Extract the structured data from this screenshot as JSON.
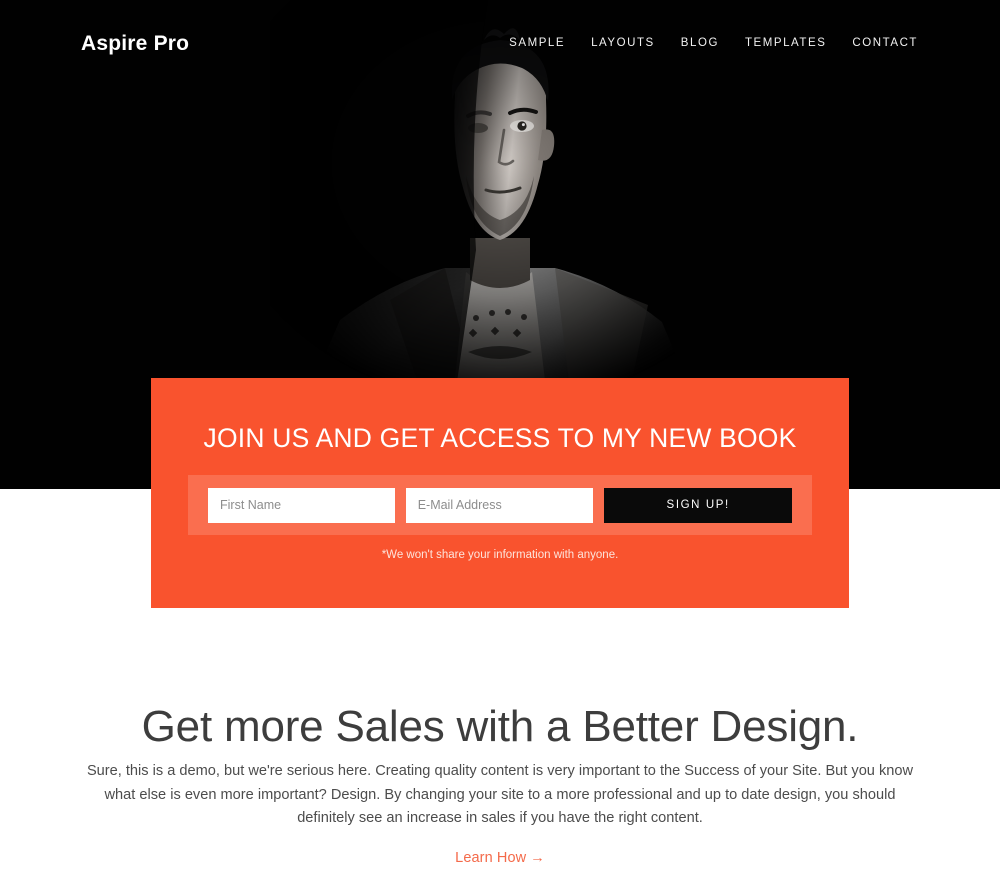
{
  "header": {
    "logo": "Aspire Pro",
    "nav": [
      {
        "label": "SAMPLE"
      },
      {
        "label": "LAYOUTS"
      },
      {
        "label": "BLOG"
      },
      {
        "label": "TEMPLATES"
      },
      {
        "label": "CONTACT"
      }
    ]
  },
  "hero": {
    "image_description": "black-and-white portrait of a man in a denim jacket on a black background",
    "background_color": "#010101"
  },
  "optin": {
    "title": "JOIN US AND GET ACCESS TO MY NEW BOOK",
    "first_name_placeholder": "First Name",
    "first_name_value": "",
    "email_placeholder": "E-Mail Address",
    "email_value": "",
    "submit_label": "SIGN UP!",
    "note": "*We won't share your information with anyone.",
    "accent_color": "#f9532e",
    "button_color": "#0a0a0a"
  },
  "content": {
    "headline": "Get more Sales with a Better Design.",
    "paragraph": "Sure, this is a demo, but we're serious here. Creating quality content is very important to the Success of your Site. But you know what else is even more important? Design. By changing your site to a more professional and up to date design, you should definitely see an increase in sales if you have the right content.",
    "learn_more_label": "Learn How",
    "learn_more_arrow": "→",
    "link_color": "#f46a4a"
  }
}
